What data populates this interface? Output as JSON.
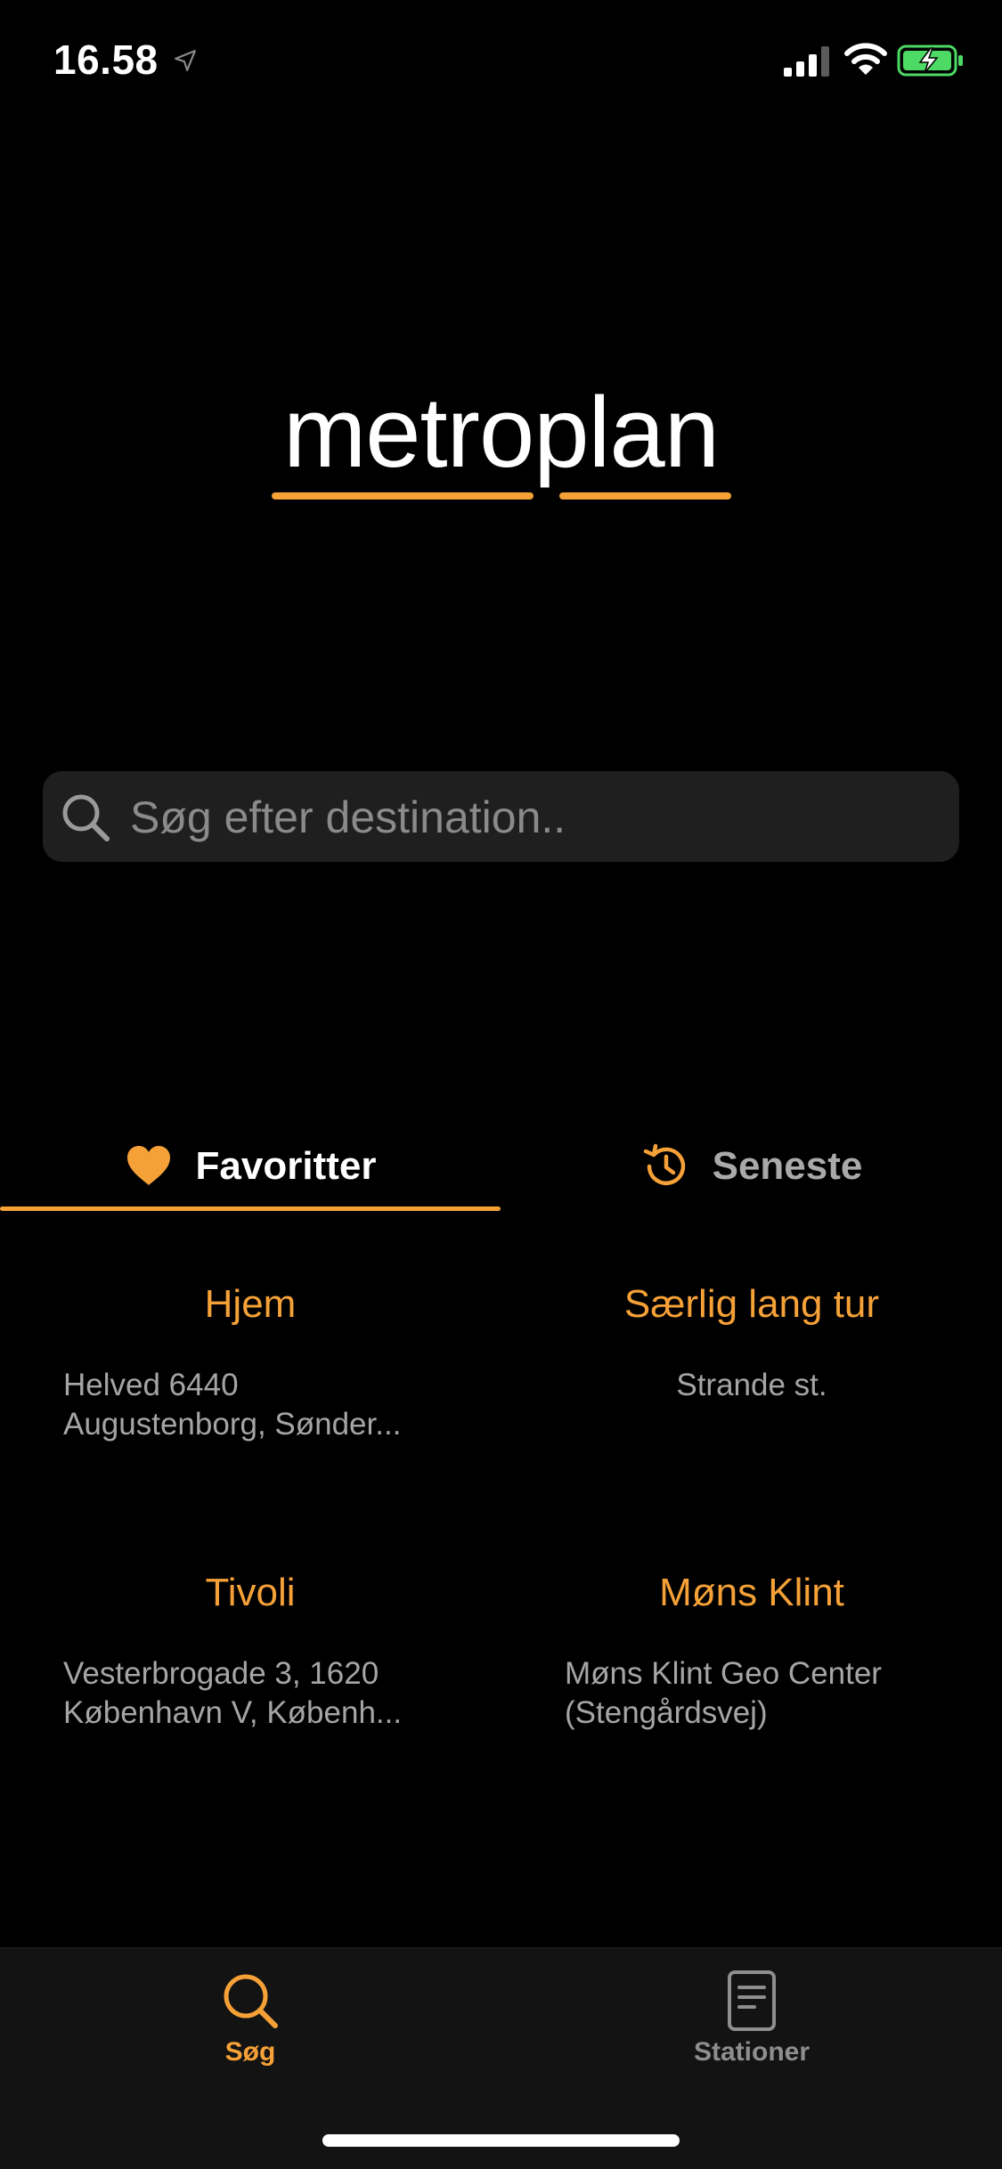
{
  "status_bar": {
    "time": "16.58",
    "icons": [
      "location-arrow-icon",
      "signal-icon",
      "wifi-icon",
      "battery-charging-icon"
    ],
    "battery_color": "#4CD964"
  },
  "logo": {
    "text": "metroplan",
    "accent_color": "#F5A137"
  },
  "search": {
    "placeholder": "Søg efter destination..",
    "value": ""
  },
  "tabs": [
    {
      "label": "Favoritter",
      "icon": "heart-icon",
      "active": true
    },
    {
      "label": "Seneste",
      "icon": "history-icon",
      "active": false
    }
  ],
  "favorites": [
    {
      "name": "Hjem",
      "address": "Helved 6440\nAugustenborg, Sønder..."
    },
    {
      "name": "Særlig lang tur",
      "address": "Strande st."
    },
    {
      "name": "Tivoli",
      "address": "Vesterbrogade 3, 1620\nKøbenhavn V, Københ..."
    },
    {
      "name": "Møns Klint",
      "address": "Møns Klint Geo Center\n(Stengårdsvej)"
    }
  ],
  "tabbar": {
    "items": [
      {
        "label": "Søg",
        "icon": "search-icon",
        "active": true
      },
      {
        "label": "Stationer",
        "icon": "document-icon",
        "active": false
      }
    ],
    "active_color": "#F5A137",
    "inactive_color": "#8e8e8e"
  }
}
